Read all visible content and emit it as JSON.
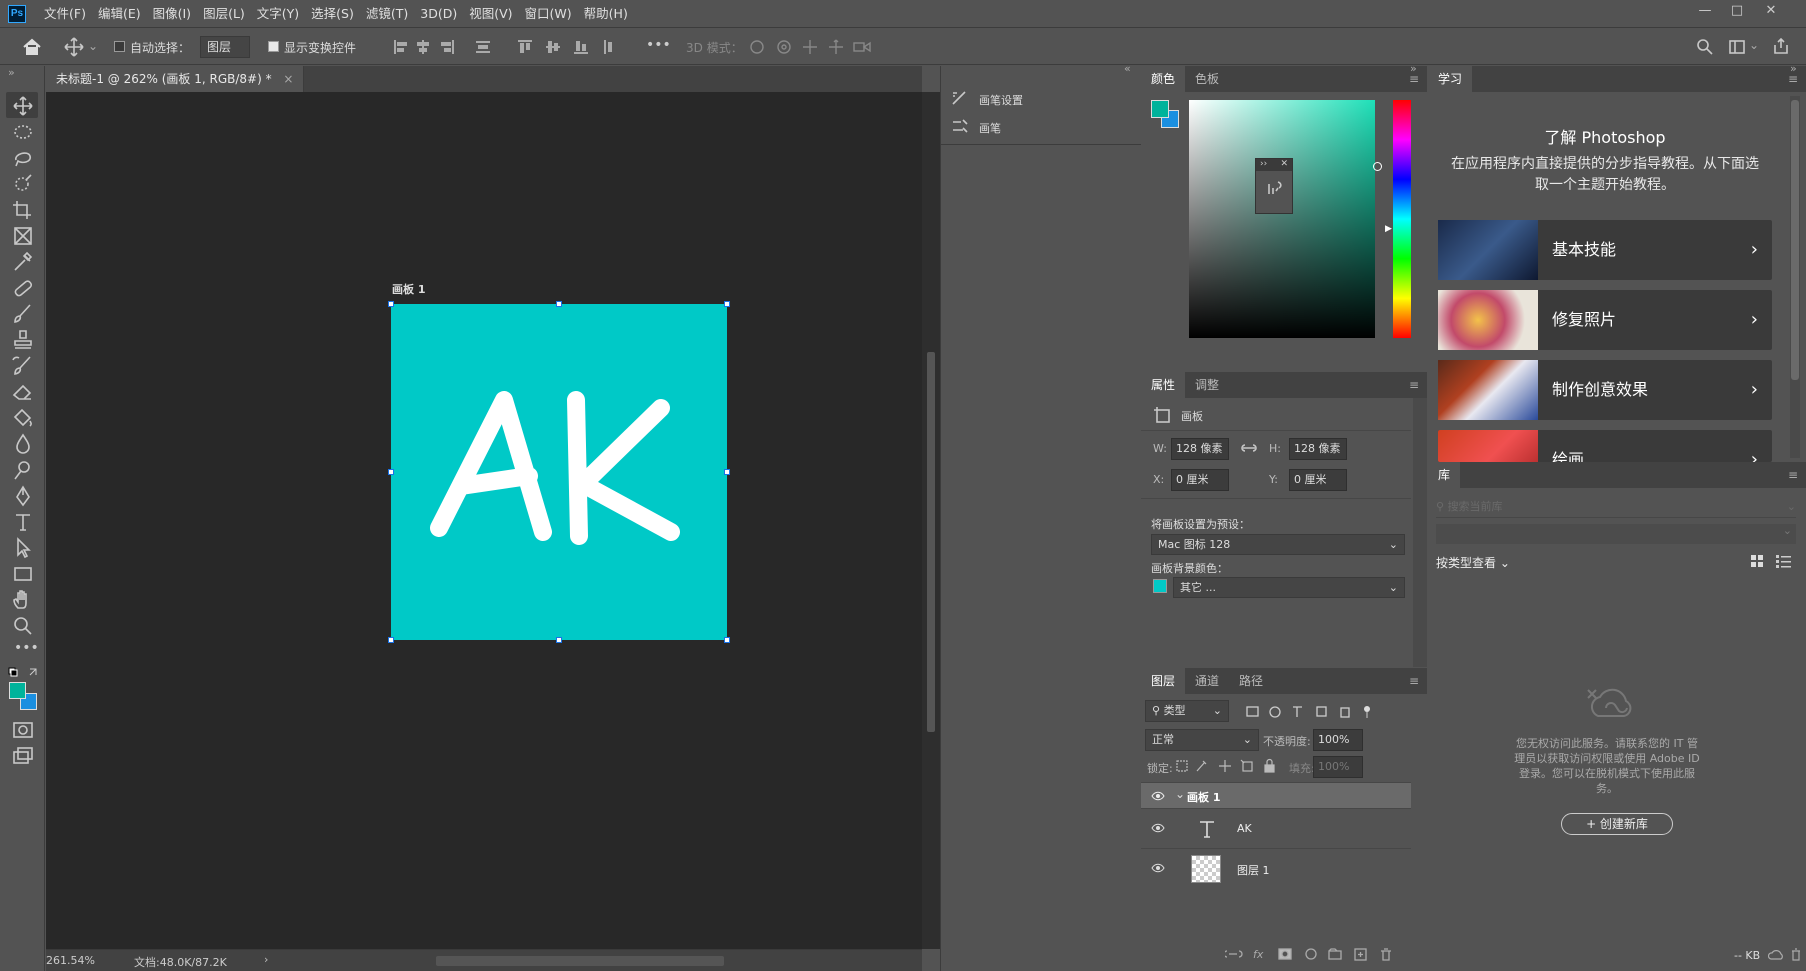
{
  "app": {
    "logo": "Ps"
  },
  "menubar": {
    "items": [
      "文件(F)",
      "编辑(E)",
      "图像(I)",
      "图层(L)",
      "文字(Y)",
      "选择(S)",
      "滤镜(T)",
      "3D(D)",
      "视图(V)",
      "窗口(W)",
      "帮助(H)"
    ]
  },
  "window_controls": {
    "minimize": "—",
    "maximize": "□",
    "close": "✕"
  },
  "options": {
    "auto_select_label": "自动选择：",
    "auto_select_target": "图层",
    "show_transform_label": "显示变换控件",
    "more": "•••",
    "mode_3d_label": "3D 模式："
  },
  "document": {
    "tab_title": "未标题-1 @ 262% (画板 1, RGB/8#) *",
    "close": "×",
    "artboard_label": "画板 1",
    "canvas_color": "#00c9c7",
    "canvas_text": "AK"
  },
  "status": {
    "zoom": "261.54%",
    "doc": "文档:48.0K/87.2K",
    "arrow": "›"
  },
  "brush_panel": {
    "items": [
      "画笔设置",
      "画笔"
    ]
  },
  "color_panel": {
    "tabs": [
      "颜色",
      "色板"
    ],
    "foreground": "#00b39b",
    "background": "#1a8fe0"
  },
  "properties": {
    "tabs": [
      "属性",
      "调整"
    ],
    "section_title": "画板",
    "w_label": "W:",
    "w_value": "128 像素",
    "h_label": "H:",
    "h_value": "128 像素",
    "x_label": "X:",
    "x_value": "0 厘米",
    "y_label": "Y:",
    "y_value": "0 厘米",
    "preset_label": "将画板设置为预设：",
    "preset_value": "Mac 图标  128",
    "bg_label": "画板背景颜色：",
    "bg_value": "其它 ...",
    "bg_color": "#00c9c7"
  },
  "layers": {
    "tabs": [
      "图层",
      "通道",
      "路径"
    ],
    "filter_kind": "类型",
    "blend_mode": "正常",
    "opacity_label": "不透明度:",
    "opacity_value": "100%",
    "lock_label": "锁定:",
    "fill_label": "填充:",
    "fill_value": "100%",
    "rows": [
      {
        "name": "画板 1"
      },
      {
        "name": "AK"
      },
      {
        "name": "图层 1"
      }
    ]
  },
  "learn": {
    "tab": "学习",
    "title": "了解 Photoshop",
    "subtitle": "在应用程序内直接提供的分步指导教程。从下面选取一个主题开始教程。",
    "tutorials": [
      "基本技能",
      "修复照片",
      "制作创意效果",
      "绘画"
    ]
  },
  "library": {
    "tab": "库",
    "search_placeholder": "搜索当前库",
    "view_by": "按类型查看",
    "message": "您无权访问此服务。请联系您的 IT 管理员以获取访问权限或使用 Adobe ID 登录。您可以在脱机模式下使用此服务。",
    "create_button": "+ 创建新库",
    "size": "-- KB"
  }
}
